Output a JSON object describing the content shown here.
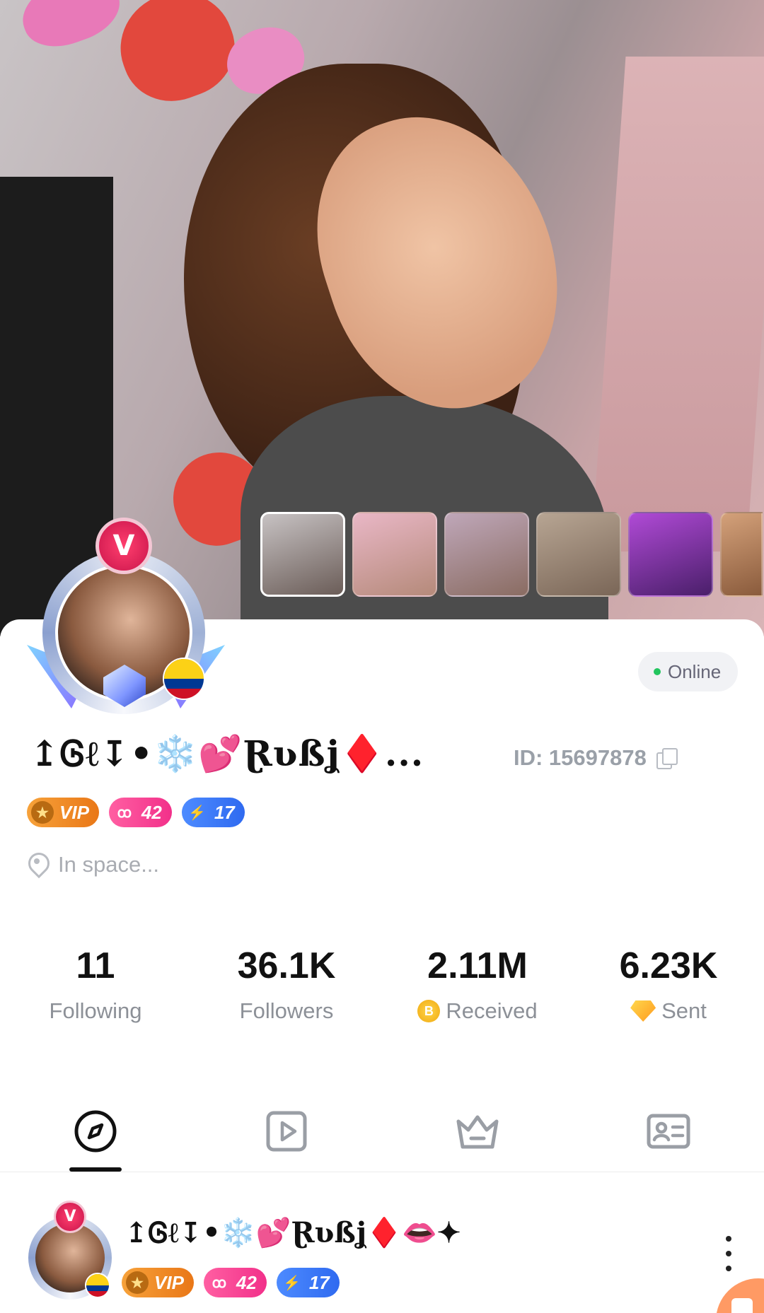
{
  "profile": {
    "status": "Online",
    "name": "↥Ꮆℓ↧•❄️💕Ɽʋßʝ♦️...",
    "id_text": "ID: 15697878",
    "location": "In space...",
    "badges": {
      "vip": "VIP",
      "level": "42",
      "energy": "17"
    },
    "avatar_badge": "V"
  },
  "stats": [
    {
      "value": "11",
      "label": "Following"
    },
    {
      "value": "36.1K",
      "label": "Followers"
    },
    {
      "value": "2.11M",
      "label": "Received"
    },
    {
      "value": "6.23K",
      "label": "Sent"
    }
  ],
  "tabs": [
    {
      "icon": "compass-icon"
    },
    {
      "icon": "video-icon"
    },
    {
      "icon": "crown-icon"
    },
    {
      "icon": "profile-card-icon"
    }
  ],
  "post": {
    "name": "↥Ꮆℓ↧•❄️💕Ɽʋßʝ♦️👄✦",
    "vip": "VIP",
    "level": "42",
    "energy": "17",
    "avatar_badge": "V"
  },
  "colors": {
    "online_dot": "#22c55e",
    "vip": "#f08a24",
    "level": "#f2308a",
    "energy": "#2f6af0",
    "coin": "#f0a910"
  }
}
